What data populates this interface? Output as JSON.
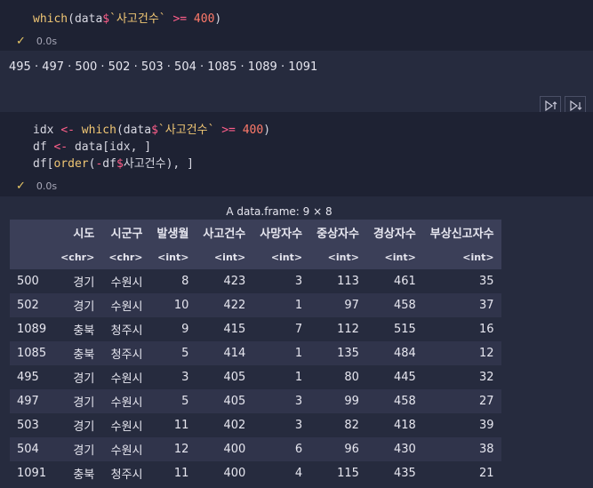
{
  "cell1": {
    "code": {
      "fn": "which",
      "open": "(data",
      "dollar": "$",
      "col": "`사고건수`",
      "op": ">=",
      "num": "400",
      "close": ")"
    },
    "time": "0.0s"
  },
  "output1": "495 · 497 · 500 · 502 · 503 · 504 · 1085 · 1089 · 1091",
  "cell2": {
    "line1": {
      "var": "idx",
      "assign": "<-",
      "fn": "which",
      "open": "(data",
      "dollar": "$",
      "col": "`사고건수`",
      "op": ">=",
      "num": "400",
      "close": ")"
    },
    "line2": {
      "var": "df",
      "assign": "<-",
      "rest": "data[idx, ]"
    },
    "line3": {
      "a": "df[",
      "fn": "order",
      "b": "(",
      "neg": "-",
      "c": "df",
      "dollar": "$",
      "d": "사고건수), ]"
    },
    "time": "0.0s"
  },
  "table": {
    "caption": "A data.frame: 9 × 8",
    "columns": [
      "",
      "시도",
      "시군구",
      "발생월",
      "사고건수",
      "사망자수",
      "중상자수",
      "경상자수",
      "부상신고자수"
    ],
    "types": [
      "",
      "<chr>",
      "<chr>",
      "<int>",
      "<int>",
      "<int>",
      "<int>",
      "<int>",
      "<int>"
    ],
    "rows": [
      [
        "500",
        "경기",
        "수원시",
        "8",
        "423",
        "3",
        "113",
        "461",
        "35"
      ],
      [
        "502",
        "경기",
        "수원시",
        "10",
        "422",
        "1",
        "97",
        "458",
        "37"
      ],
      [
        "1089",
        "충북",
        "청주시",
        "9",
        "415",
        "7",
        "112",
        "515",
        "16"
      ],
      [
        "1085",
        "충북",
        "청주시",
        "5",
        "414",
        "1",
        "135",
        "484",
        "12"
      ],
      [
        "495",
        "경기",
        "수원시",
        "3",
        "405",
        "1",
        "80",
        "445",
        "32"
      ],
      [
        "497",
        "경기",
        "수원시",
        "5",
        "405",
        "3",
        "99",
        "458",
        "27"
      ],
      [
        "503",
        "경기",
        "수원시",
        "11",
        "402",
        "3",
        "82",
        "418",
        "39"
      ],
      [
        "504",
        "경기",
        "수원시",
        "12",
        "400",
        "6",
        "96",
        "430",
        "38"
      ],
      [
        "1091",
        "충북",
        "청주시",
        "11",
        "400",
        "4",
        "115",
        "435",
        "21"
      ]
    ]
  },
  "icons": {
    "run_above": "run-above-icon",
    "run_below": "run-below-icon",
    "check": "check-icon"
  }
}
